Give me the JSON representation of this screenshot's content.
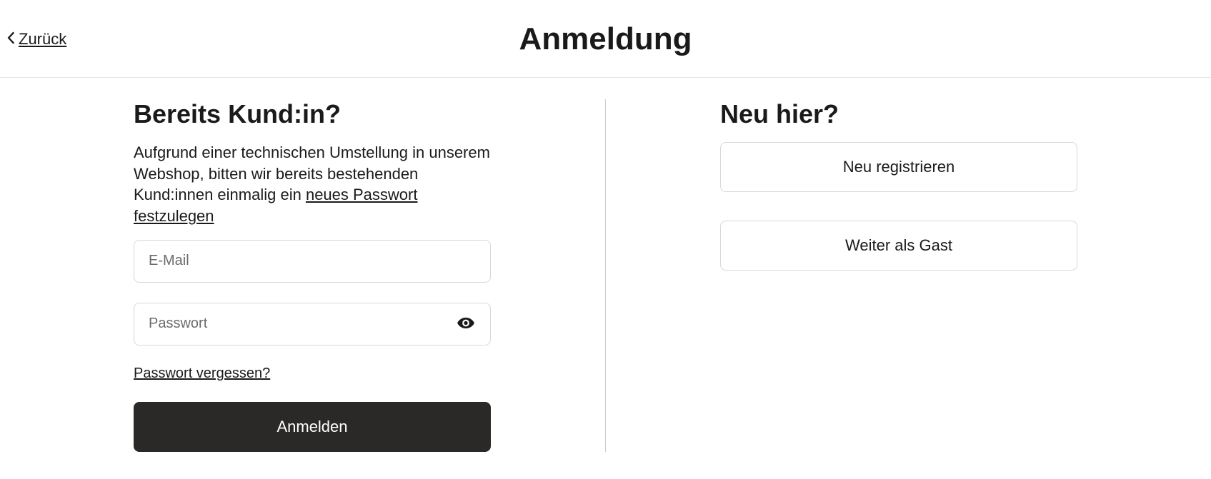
{
  "header": {
    "back_label": "Zurück",
    "title": "Anmeldung"
  },
  "left": {
    "heading": "Bereits Kund:in?",
    "notice_prefix": "Aufgrund einer technischen Umstellung in unserem Webshop, bitten wir bereits bestehenden Kund:innen einmalig ein ",
    "notice_link": "neues Passwort festzulegen",
    "email_placeholder": "E-Mail",
    "email_value": "",
    "password_placeholder": "Passwort",
    "password_value": "",
    "forgot_label": "Passwort vergessen?",
    "login_label": "Anmelden"
  },
  "right": {
    "heading": "Neu hier?",
    "register_label": "Neu registrieren",
    "guest_label": "Weiter als Gast"
  }
}
